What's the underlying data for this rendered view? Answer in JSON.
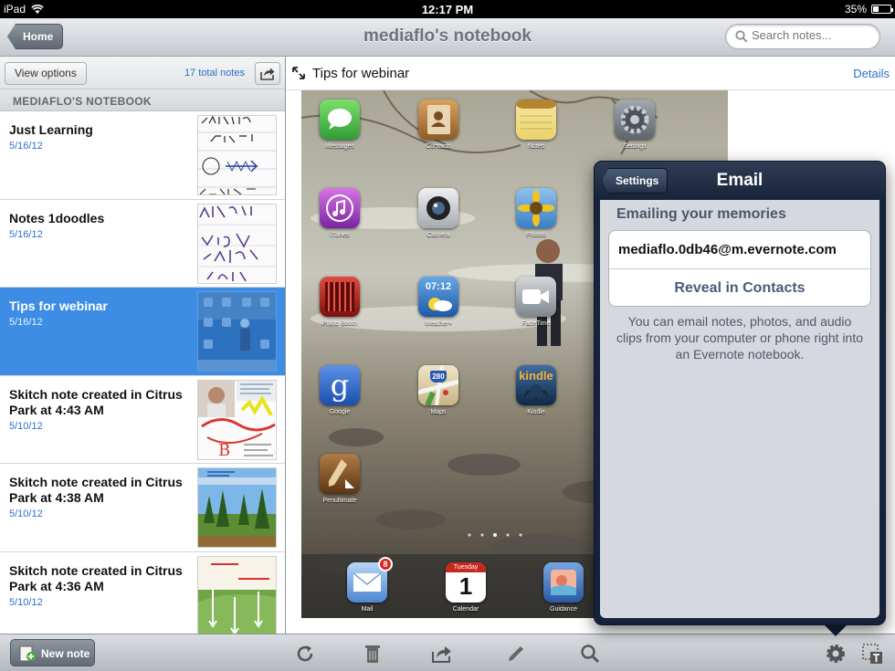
{
  "status_bar": {
    "device": "iPad",
    "time": "12:17 PM",
    "battery_text": "35%",
    "battery_level": 0.35
  },
  "nav": {
    "back_label": "Home",
    "title": "mediaflo's notebook",
    "search_placeholder": "Search notes..."
  },
  "sidebar": {
    "view_options_label": "View options",
    "total_notes": "17 total notes",
    "section_title": "MEDIAFLO'S NOTEBOOK",
    "notes": [
      {
        "title": "Just Learning",
        "date": "5/16/12",
        "selected": false
      },
      {
        "title": "Notes 1doodles",
        "date": "5/16/12",
        "selected": false
      },
      {
        "title": "Tips for webinar",
        "date": "5/16/12",
        "selected": true
      },
      {
        "title": "Skitch note created in Citrus Park at 4:43 AM",
        "date": "5/10/12",
        "selected": false
      },
      {
        "title": "Skitch note created in Citrus Park at 4:38 AM",
        "date": "5/10/12",
        "selected": false
      },
      {
        "title": "Skitch note created in Citrus Park at 4:36 AM",
        "date": "5/10/12",
        "selected": false
      }
    ]
  },
  "detail": {
    "title": "Tips for webinar",
    "details_link": "Details",
    "home_screen_apps": [
      {
        "label": "Messages",
        "icon": "messages-icon",
        "color": "#3fb44b"
      },
      {
        "label": "Contacts",
        "icon": "contacts-icon",
        "color": "#b07a3e"
      },
      {
        "label": "Notes",
        "icon": "notes-icon",
        "color": "#f1d95a"
      },
      {
        "label": "Settings",
        "icon": "settings-icon",
        "color": "#7d858d"
      },
      {
        "label": "iTunes",
        "icon": "itunes-icon",
        "color": "#9b3bb4"
      },
      {
        "label": "Camera",
        "icon": "camera-icon",
        "color": "#c9ccd0"
      },
      {
        "label": "Photos",
        "icon": "photos-icon",
        "color": "#5e9bd6"
      },
      {
        "label": "Photo Booth",
        "icon": "photo-booth-icon",
        "color": "#b2231e"
      },
      {
        "label": "Weather+",
        "icon": "weather-icon",
        "color": "#2f79c9"
      },
      {
        "label": "FaceTime",
        "icon": "facetime-icon",
        "color": "#a5abb2"
      },
      {
        "label": "Google",
        "icon": "google-icon",
        "color": "#2a64c9"
      },
      {
        "label": "Maps",
        "icon": "maps-icon",
        "color": "#d9c89a"
      },
      {
        "label": "Kindle",
        "icon": "kindle-icon",
        "color": "#1d3f6b"
      },
      {
        "label": "Penultimate",
        "icon": "penultimate-icon",
        "color": "#7a4c22"
      }
    ],
    "weather_time": "07:12",
    "maps_badge": "280",
    "google_letter": "g",
    "kindle_text": "kindle",
    "dock_apps": [
      {
        "label": "Mail",
        "icon": "mail-icon",
        "color": "#6fa4de",
        "badge": "8"
      },
      {
        "label": "Calendar",
        "icon": "calendar-icon",
        "color": "#ffffff",
        "day_name": "Tuesday",
        "day_number": "1"
      },
      {
        "label": "Guidance",
        "icon": "guidance-icon",
        "color": "#3f73c4"
      }
    ]
  },
  "toolbar": {
    "new_note_label": "New note"
  },
  "email_popover": {
    "back_label": "Settings",
    "title": "Email",
    "section_title": "Emailing your memories",
    "email_address": "mediaflo.0db46@m.evernote.com",
    "reveal_label": "Reveal in Contacts",
    "help_text": "You can email notes, photos, and audio clips from your computer or phone right into an Evernote notebook."
  }
}
